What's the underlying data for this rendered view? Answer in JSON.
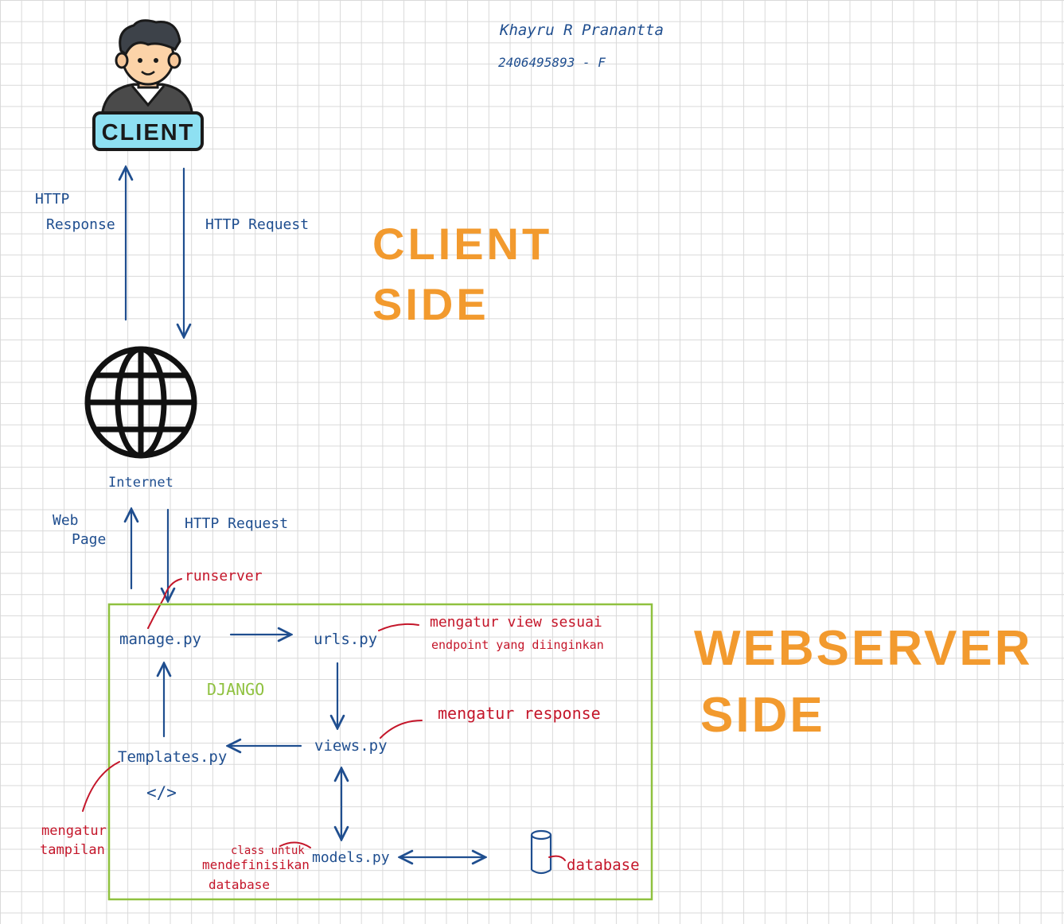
{
  "author": {
    "name": "Khayru R Pranantta",
    "id": "2406495893 - F"
  },
  "client_badge": "CLIENT",
  "client_side": {
    "line1": "CLIENT",
    "line2": "SIDE"
  },
  "webserver_side": {
    "line1": "WEBSERVER",
    "line2": "SIDE"
  },
  "top_flow": {
    "response_line1": "HTTP",
    "response_line2": "Response",
    "request": "HTTP Request"
  },
  "internet_label": "Internet",
  "mid_flow": {
    "webpage_line1": "Web",
    "webpage_line2": "Page",
    "request": "HTTP Request",
    "runserver": "runserver"
  },
  "django": {
    "label": "DJANGO",
    "manage": "manage.py",
    "urls": "urls.py",
    "urls_note_line1": "mengatur view sesuai",
    "urls_note_line2": "endpoint yang diinginkan",
    "views": "views.py",
    "views_note": "mengatur response",
    "templates": "Templates.py",
    "templates_icon": "</>",
    "templates_note_line1": "mengatur",
    "templates_note_line2": "tampilan",
    "models": "models.py",
    "models_note_line1": "class untuk",
    "models_note_line2": "mendefinisikan",
    "models_note_line3": "database",
    "database": "database"
  },
  "icons": [
    "client-person-icon",
    "globe-icon",
    "code-icon",
    "database-cylinder-icon"
  ],
  "colors": {
    "ink_blue": "#1f4e8f",
    "ink_red": "#c4162a",
    "heading_orange": "#f29a2e",
    "frame_green": "#8fc13f",
    "badge_fill": "#8ee0f2",
    "grid": "#d9d9d9"
  }
}
